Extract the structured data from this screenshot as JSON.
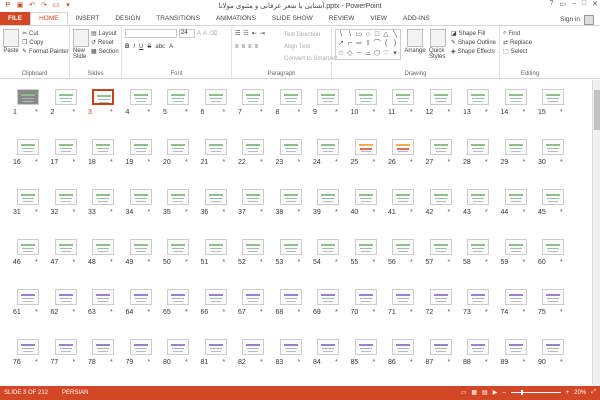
{
  "window": {
    "title": "آشنایی با شعر عرفانی و مثنوی مولانا.pptx - PowerPoint",
    "controls": [
      "?",
      "▭",
      "–",
      "□",
      "✕"
    ]
  },
  "qat": [
    "save-icon",
    "undo-icon",
    "redo-icon",
    "start-icon",
    "customize-icon"
  ],
  "tabs": [
    {
      "label": "FILE"
    },
    {
      "label": "HOME"
    },
    {
      "label": "INSERT"
    },
    {
      "label": "DESIGN"
    },
    {
      "label": "TRANSITIONS"
    },
    {
      "label": "ANIMATIONS"
    },
    {
      "label": "SLIDE SHOW"
    },
    {
      "label": "REVIEW"
    },
    {
      "label": "VIEW"
    },
    {
      "label": "ADD-INS"
    }
  ],
  "signin": "Sign in",
  "ribbon": {
    "clipboard": {
      "paste": "Paste",
      "cut": "Cut",
      "copy": "Copy",
      "format_painter": "Format Painter",
      "label": "Clipboard"
    },
    "slides": {
      "new_slide": "New Slide",
      "layout": "Layout",
      "reset": "Reset",
      "section": "Section",
      "label": "Slides"
    },
    "font": {
      "size": "24",
      "label": "Font"
    },
    "paragraph": {
      "text_direction": "Text Direction",
      "align_text": "Align Text",
      "convert": "Convert to SmartArt",
      "label": "Paragraph"
    },
    "drawing": {
      "arrange": "Arrange",
      "quick_styles": "Quick Styles",
      "shape_fill": "Shape Fill",
      "shape_outline": "Shape Outline",
      "shape_effects": "Shape Effects",
      "label": "Drawing"
    },
    "editing": {
      "find": "Find",
      "replace": "Replace",
      "select": "Select",
      "label": "Editing"
    }
  },
  "slides": {
    "rows": [
      [
        "1",
        "2",
        "3",
        "4",
        "5",
        "6",
        "7",
        "8",
        "9",
        "10",
        "11",
        "12",
        "13",
        "14",
        "15"
      ],
      [
        "16",
        "17",
        "18",
        "19",
        "20",
        "21",
        "22",
        "23",
        "24",
        "25",
        "26",
        "27",
        "28",
        "29",
        "30"
      ],
      [
        "31",
        "32",
        "33",
        "34",
        "35",
        "36",
        "37",
        "38",
        "39",
        "40",
        "41",
        "42",
        "43",
        "44",
        "45"
      ],
      [
        "46",
        "47",
        "48",
        "49",
        "50",
        "51",
        "52",
        "53",
        "54",
        "55",
        "56",
        "57",
        "58",
        "59",
        "60"
      ],
      [
        "61",
        "62",
        "63",
        "64",
        "65",
        "66",
        "67",
        "68",
        "69",
        "70",
        "71",
        "72",
        "73",
        "74",
        "75"
      ],
      [
        "76",
        "77",
        "78",
        "79",
        "80",
        "81",
        "82",
        "83",
        "84",
        "85",
        "86",
        "87",
        "88",
        "89",
        "90"
      ]
    ],
    "star": "*",
    "selected": "3"
  },
  "status": {
    "slide": "SLIDE 3 OF 212",
    "language": "PERSIAN",
    "zoom": "20%"
  }
}
